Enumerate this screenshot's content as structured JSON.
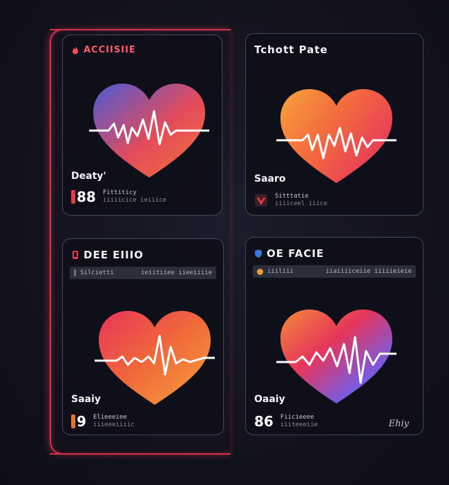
{
  "colors": {
    "frame_accent": "#d8324e",
    "card_border": "#444a5c",
    "pulse_line": "#ffffff"
  },
  "cards": [
    {
      "title": "ACCIISIIE",
      "icon": "flame-icon",
      "stat_label": "Deaty'",
      "value": "88",
      "desc_line1": "Fittiticy",
      "desc_line2": "iiiiicice ieiiice",
      "heart_gradient": [
        "#4b5bd6",
        "#e44b5a",
        "#f2733a"
      ]
    },
    {
      "title": "Tchott Pate",
      "icon": "",
      "stat_label": "Saaro",
      "value": "",
      "desc_line1": "Sitttatie",
      "desc_line2": "iiiiceel iiice",
      "heart_gradient": [
        "#f7a13a",
        "#f36b3f",
        "#e6395a"
      ]
    },
    {
      "title": "DEE EIIIO",
      "icon": "phone-icon",
      "subbar_left": "Silcietti",
      "subbar_right": "ieiitiiee iieeiiiie",
      "stat_label": "Saaiy",
      "value": "9",
      "desc_line1": "Elieeeiee",
      "desc_line2": "iiieeeiiiic",
      "heart_gradient": [
        "#e6355a",
        "#f06a3a",
        "#f6a23a"
      ]
    },
    {
      "title": "OE FACIE",
      "icon": "shield-icon",
      "subbar_left": "iiiliii",
      "subbar_right": "iiaiiiiceiie iiiiieieie",
      "stat_label": "Oaaiy",
      "value": "86",
      "desc_line1": "Fiicieeee",
      "desc_line2": "iiiteeeiie",
      "footnote": "Ehiy",
      "heart_gradient": [
        "#f38a3a",
        "#e6355a",
        "#7a5be0",
        "#3a8ae0"
      ]
    }
  ]
}
